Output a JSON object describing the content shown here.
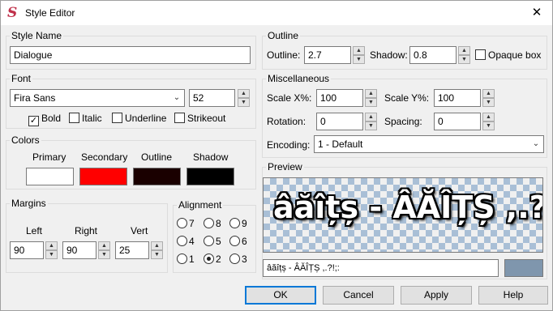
{
  "window": {
    "title": "Style Editor",
    "app_icon": "S"
  },
  "style_name": {
    "legend": "Style Name",
    "value": "Dialogue"
  },
  "font": {
    "legend": "Font",
    "family": "Fira Sans",
    "size": "52",
    "bold": {
      "label": "Bold",
      "checked": true
    },
    "italic": {
      "label": "Italic",
      "checked": false
    },
    "underline": {
      "label": "Underline",
      "checked": false
    },
    "strikeout": {
      "label": "Strikeout",
      "checked": false
    }
  },
  "colors": {
    "legend": "Colors",
    "primary": {
      "label": "Primary",
      "color": "#ffffff"
    },
    "secondary": {
      "label": "Secondary",
      "color": "#ff0000"
    },
    "outline": {
      "label": "Outline",
      "color": "#1a0000"
    },
    "shadow": {
      "label": "Shadow",
      "color": "#000000"
    }
  },
  "margins": {
    "legend": "Margins",
    "left": {
      "label": "Left",
      "value": "90"
    },
    "right": {
      "label": "Right",
      "value": "90"
    },
    "vert": {
      "label": "Vert",
      "value": "25"
    }
  },
  "alignment": {
    "legend": "Alignment",
    "options": [
      "7",
      "8",
      "9",
      "4",
      "5",
      "6",
      "1",
      "2",
      "3"
    ],
    "selected": "2"
  },
  "outline_group": {
    "legend": "Outline",
    "outline_label": "Outline:",
    "outline_value": "2.7",
    "shadow_label": "Shadow:",
    "shadow_value": "0.8",
    "opaque_box_label": "Opaque box",
    "opaque_box_checked": false
  },
  "misc": {
    "legend": "Miscellaneous",
    "scale_x_label": "Scale X%:",
    "scale_x": "100",
    "scale_y_label": "Scale Y%:",
    "scale_y": "100",
    "rotation_label": "Rotation:",
    "rotation": "0",
    "spacing_label": "Spacing:",
    "spacing": "0",
    "encoding_label": "Encoding:",
    "encoding": "1 - Default"
  },
  "preview": {
    "legend": "Preview",
    "text": "âăîțș - ÂĂÎȚȘ ,.?!;:",
    "input_value": "âăîțș - ÂĂÎȚȘ ,.?!;:",
    "bg_color": "#7f96ad"
  },
  "buttons": {
    "ok": "OK",
    "cancel": "Cancel",
    "apply": "Apply",
    "help": "Help"
  },
  "icons": {
    "close": "close-icon",
    "dropdown": "chevron-down-icon",
    "spin_up": "arrow-up-icon",
    "spin_down": "arrow-down-icon",
    "check": "checkmark-icon"
  }
}
